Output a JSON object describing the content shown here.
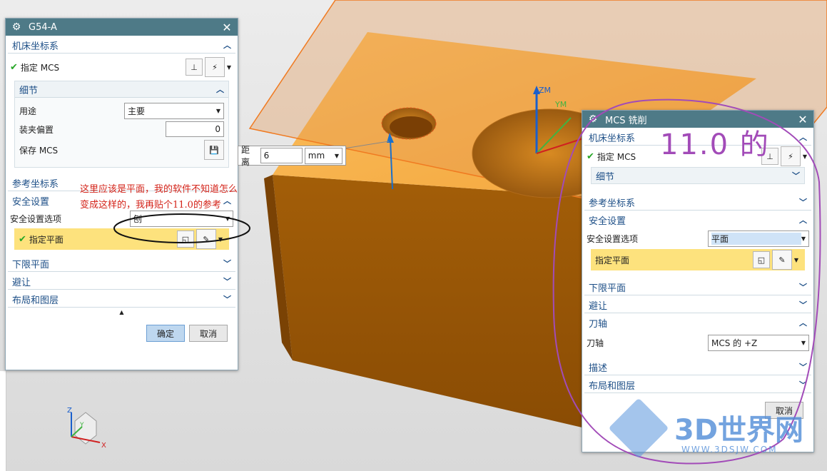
{
  "left_dialog": {
    "title": "G54-A",
    "sec_mcs": "机床坐标系",
    "specify_mcs": "指定 MCS",
    "details": {
      "title": "细节",
      "usage_label": "用途",
      "usage_value": "主要",
      "fixture_offset_label": "装夹偏置",
      "fixture_offset_value": "0",
      "save_mcs_label": "保存 MCS"
    },
    "sec_ref": "参考坐标系",
    "sec_safety": "安全设置",
    "safety_option_label": "安全设置选项",
    "safety_option_value": "刨",
    "specify_plane": "指定平面",
    "sec_lower": "下限平面",
    "sec_avoid": "避让",
    "sec_layout": "布局和图层",
    "ok": "确定",
    "cancel": "取消"
  },
  "distance_popup": {
    "label": "距离",
    "value": "6",
    "unit": "mm"
  },
  "annotation": {
    "line1": "这里应该是平面，我的软件不知道怎么",
    "line2": "变成这样的，我再贴个11.0的参考",
    "handwritten": "11.0 的"
  },
  "axes_labels": {
    "zm": "ZM",
    "ym": "YM",
    "triad_z": "Z",
    "triad_y": "Y",
    "triad_x": "X"
  },
  "right_dialog": {
    "title": "MCS 铣削",
    "sec_mcs": "机床坐标系",
    "specify_mcs": "指定 MCS",
    "details": "细节",
    "sec_ref": "参考坐标系",
    "sec_safety": "安全设置",
    "safety_option_label": "安全设置选项",
    "safety_option_value": "平面",
    "specify_plane": "指定平面",
    "sec_lower": "下限平面",
    "sec_avoid": "避让",
    "sec_tool_axis": "刀轴",
    "tool_axis_label": "刀轴",
    "tool_axis_value": "MCS 的 +Z",
    "sec_desc": "描述",
    "sec_layout": "布局和图层",
    "cancel": "取消"
  },
  "watermark": {
    "text": "3D世界网",
    "url": "WWW.3DSJW.COM"
  },
  "colors": {
    "titlebar": "#4e7a87",
    "section_text": "#1d4f87",
    "highlight_yellow": "#fde27d",
    "part_orange": "#f5a942",
    "annotation_red": "#d4241a",
    "marker_purple": "#a24bb8"
  }
}
